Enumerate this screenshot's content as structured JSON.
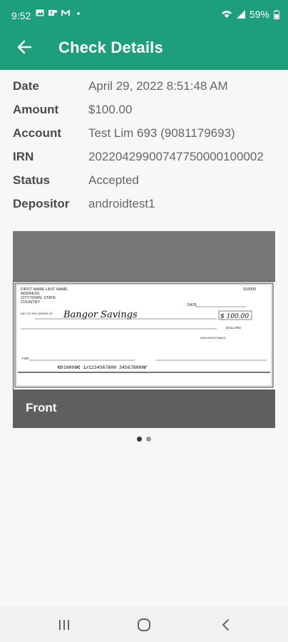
{
  "status_bar": {
    "time": "9:52",
    "battery": "59%",
    "icons_left": [
      "gallery-icon",
      "teams-icon",
      "gmail-icon",
      "dot-icon"
    ],
    "icons_right": [
      "vowifi-icon",
      "signal-icon",
      "battery-icon"
    ]
  },
  "app_bar": {
    "title": "Check Details",
    "back_icon": "arrow-back-icon"
  },
  "details": [
    {
      "label": "Date",
      "value": "April 29, 2022 8:51:48 AM"
    },
    {
      "label": "Amount",
      "value": "$100.00"
    },
    {
      "label": "Account",
      "value": "Test Lim 693 (9081179693)"
    },
    {
      "label": "IRN",
      "value": "20220429900747750000100002"
    },
    {
      "label": "Status",
      "value": "Accepted"
    },
    {
      "label": "Depositor",
      "value": "androidtest1"
    }
  ],
  "check": {
    "caption": "Front",
    "header_lines": [
      "FIRST NAME LAST NAME",
      "ADDRESS",
      "CITYTOWN, STATE",
      "COUNTRY"
    ],
    "check_number": "310095",
    "date_label": "DATE",
    "pay_to_label": "PAY TO THE ORDER OF",
    "payee_written": "Bangor Savings",
    "amount_written": "$ 100.00",
    "dollars_label": "DOLLARS",
    "non_negotiable": "NON-NEGOTIABLE",
    "for_label": "FOR",
    "micr_line": "⑆010098⑆  1⑇1234567800  345678000⑈"
  },
  "pager": {
    "count": 2,
    "active": 0
  },
  "nav_bar": {
    "buttons": [
      "recent-apps-button",
      "home-button",
      "back-button"
    ]
  }
}
